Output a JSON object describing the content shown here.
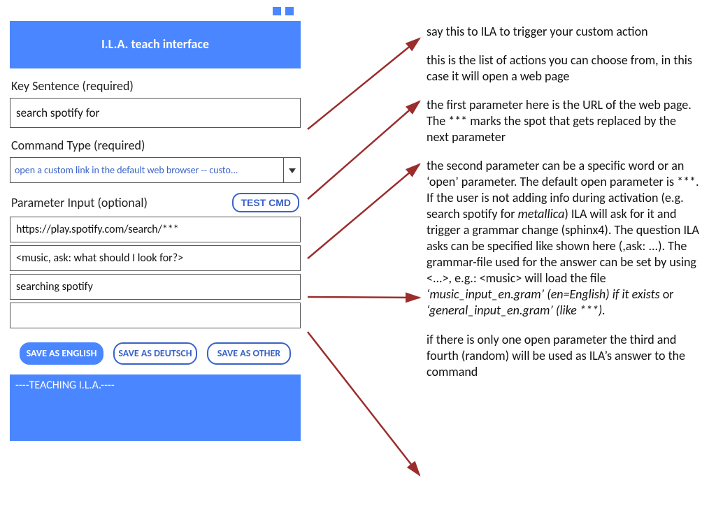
{
  "header": {
    "title": "I.L.A. teach interface"
  },
  "labels": {
    "keySentence": "Key Sentence (required)",
    "commandType": "Command Type (required)",
    "paramInput": "Parameter Input (optional)"
  },
  "fields": {
    "keySentence": "search spotify for",
    "commandType": "open a custom link in the default web browser -- custo...",
    "param1": "https://play.spotify.com/search/***",
    "param2": "<music, ask: what should I look for?>",
    "param3": "searching spotify",
    "param4": ""
  },
  "buttons": {
    "testCmd": "TEST CMD",
    "saveEnglish": "SAVE AS ENGLISH",
    "saveDeutsch": "SAVE AS DEUTSCH",
    "saveOther": "SAVE AS OTHER"
  },
  "log": "----TEACHING I.L.A.----",
  "notes": {
    "n1": "say this to ILA to trigger your custom action",
    "n2": "this is the list of actions you can choose from, in this case it will open a web page",
    "n3": "the first parameter here is the URL of the web page. The *** marks the spot that gets replaced by the next parameter",
    "n4a": "the second parameter can be a specific word or an ‘open’ parameter. The default open parameter is ***. If the user is not adding info during activation (e.g. search spotify for ",
    "n4italic1": "metallica",
    "n4b": ") ILA will ask for it and trigger a grammar change (sphinx4). The question ILA asks can be specified like shown here (,ask: ...). The grammar-file used for the answer can be set by using <...>, e.g.: <music> will load the file ",
    "n4italic2": "‘music_input_en.gram’ (en=English) if it exists",
    "n4c": " or ",
    "n4italic3": "‘general_input_en.gram’ (like ***).",
    "n5": "if there is only one open parameter the third and fourth (random) will be used as ILA’s answer to the command"
  }
}
